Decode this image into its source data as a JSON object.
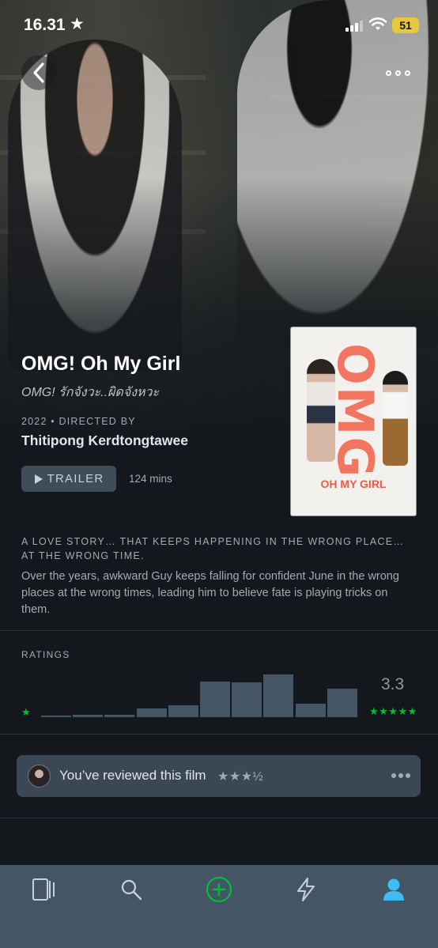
{
  "status_bar": {
    "time": "16.31",
    "battery": "51"
  },
  "film": {
    "title": "OMG! Oh My Girl",
    "alt_title": "OMG! รักจังวะ..ผิดจังหวะ",
    "meta": "2022 • DIRECTED BY",
    "director": "Thitipong Kerdtongtawee",
    "trailer_label": "TRAILER",
    "runtime": "124 mins",
    "poster": {
      "title_art": "OMG",
      "subtitle_art": "OH MY GIRL"
    },
    "tagline": "A LOVE STORY… THAT KEEPS HAPPENING IN THE WRONG PLACE… AT THE WRONG TIME.",
    "synopsis": "Over the years, awkward Guy keeps falling for confident June in the wrong places at the wrong times, leading him to believe fate is playing tricks on them."
  },
  "ratings": {
    "label": "RATINGS",
    "average": "3.3",
    "min_star": "★",
    "max_stars": "★★★★★",
    "histogram": [
      0.03,
      0.05,
      0.05,
      0.17,
      0.22,
      0.67,
      0.65,
      0.81,
      0.25,
      0.53
    ],
    "bar_color": "#445566",
    "star_color": "#00c030"
  },
  "review": {
    "text": "You’ve reviewed this film",
    "stars": "★★★½"
  },
  "tabs": [
    {
      "name": "films",
      "icon": "films-icon"
    },
    {
      "name": "search",
      "icon": "search-icon"
    },
    {
      "name": "add",
      "icon": "add-icon"
    },
    {
      "name": "activity",
      "icon": "lightning-icon"
    },
    {
      "name": "profile",
      "icon": "profile-icon"
    }
  ]
}
